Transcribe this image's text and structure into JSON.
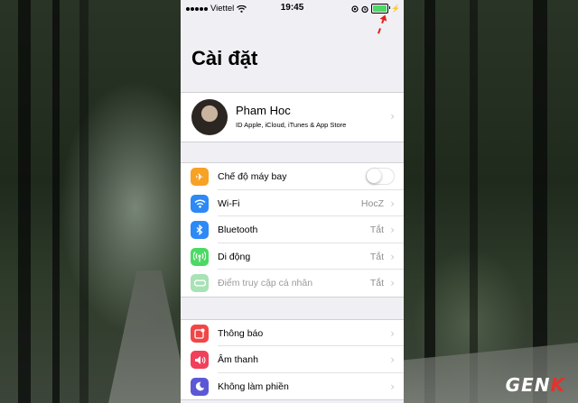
{
  "status_bar": {
    "carrier": "Viettel",
    "time": "19:45"
  },
  "header": {
    "title": "Cài đặt"
  },
  "profile": {
    "name": "Pham Hoc",
    "subtitle": "ID Apple, iCloud, iTunes & App Store"
  },
  "group1": [
    {
      "label": "Chế độ máy bay",
      "value": "",
      "icon": "airplane-icon",
      "color": "#f7a125"
    },
    {
      "label": "Wi-Fi",
      "value": "HocZ",
      "icon": "wifi-icon",
      "color": "#2d89f5"
    },
    {
      "label": "Bluetooth",
      "value": "Tắt",
      "icon": "bluetooth-icon",
      "color": "#2d89f5"
    },
    {
      "label": "Di động",
      "value": "Tắt",
      "icon": "cellular-icon",
      "color": "#4cd964"
    },
    {
      "label": "Điểm truy cập cá nhân",
      "value": "Tắt",
      "icon": "hotspot-icon",
      "color": "#a8e2b5"
    }
  ],
  "group2": [
    {
      "label": "Thông báo",
      "icon": "notifications-icon",
      "color": "#f24646"
    },
    {
      "label": "Âm thanh",
      "icon": "sounds-icon",
      "color": "#f0405c"
    },
    {
      "label": "Không làm phiền",
      "icon": "do-not-disturb-icon",
      "color": "#5b58d6"
    }
  ],
  "watermark": {
    "main": "GEN",
    "accent": "K"
  }
}
